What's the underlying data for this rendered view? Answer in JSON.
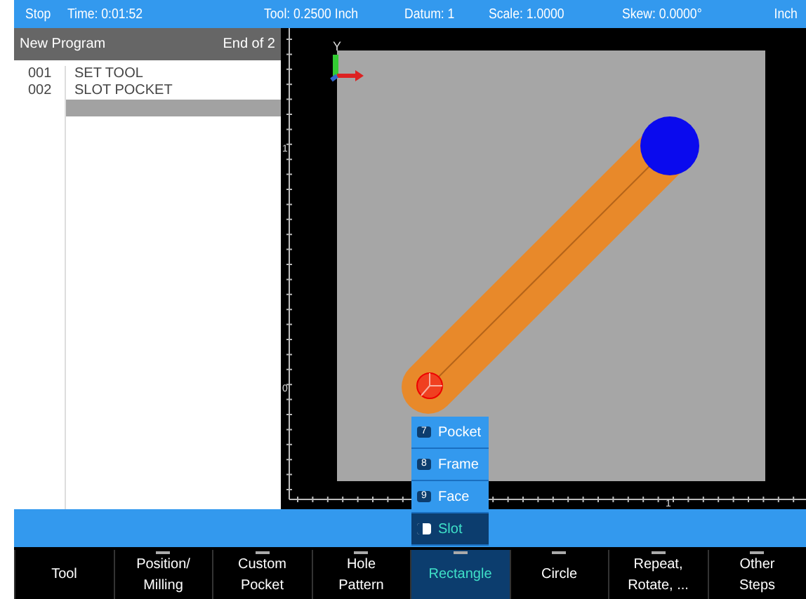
{
  "status_bar": [
    "Stop",
    "Time: 0:01:52",
    "Tool: 0.2500 Inch",
    "Datum: 1",
    "Scale: 1.0000",
    "Skew: 0.0000°",
    "Inch"
  ],
  "program": {
    "title": "New Program",
    "position": "End of 2",
    "lines": [
      {
        "number": "001",
        "text": "SET TOOL",
        "selected": false
      },
      {
        "number": "002",
        "text": "SLOT POCKET",
        "selected": false
      },
      {
        "selected": true
      }
    ]
  },
  "canvas": {
    "axis_label": "Y",
    "left_ruler_labels": [
      "1",
      "0"
    ],
    "bottom_ruler_label": "1"
  },
  "popup_menu": [
    {
      "key": "7",
      "label": "Pocket",
      "selected": false
    },
    {
      "key": "8",
      "label": "Frame",
      "selected": false
    },
    {
      "key": "9",
      "label": "Face",
      "selected": false
    },
    {
      "label": "Slot",
      "selected": true
    }
  ],
  "soft_keys": [
    {
      "label": "Tool",
      "selected": false,
      "submenu": false
    },
    {
      "label": "Position/\nMilling",
      "selected": false,
      "submenu": true
    },
    {
      "label": "Custom\nPocket",
      "selected": false,
      "submenu": true
    },
    {
      "label": "Hole\nPattern",
      "selected": false,
      "submenu": true
    },
    {
      "label": "Rectangle",
      "selected": true,
      "submenu": true
    },
    {
      "label": "Circle",
      "selected": false,
      "submenu": true
    },
    {
      "label": "Repeat,\nRotate, ...",
      "selected": false,
      "submenu": true
    },
    {
      "label": "Other\nSteps",
      "selected": false,
      "submenu": true
    }
  ]
}
